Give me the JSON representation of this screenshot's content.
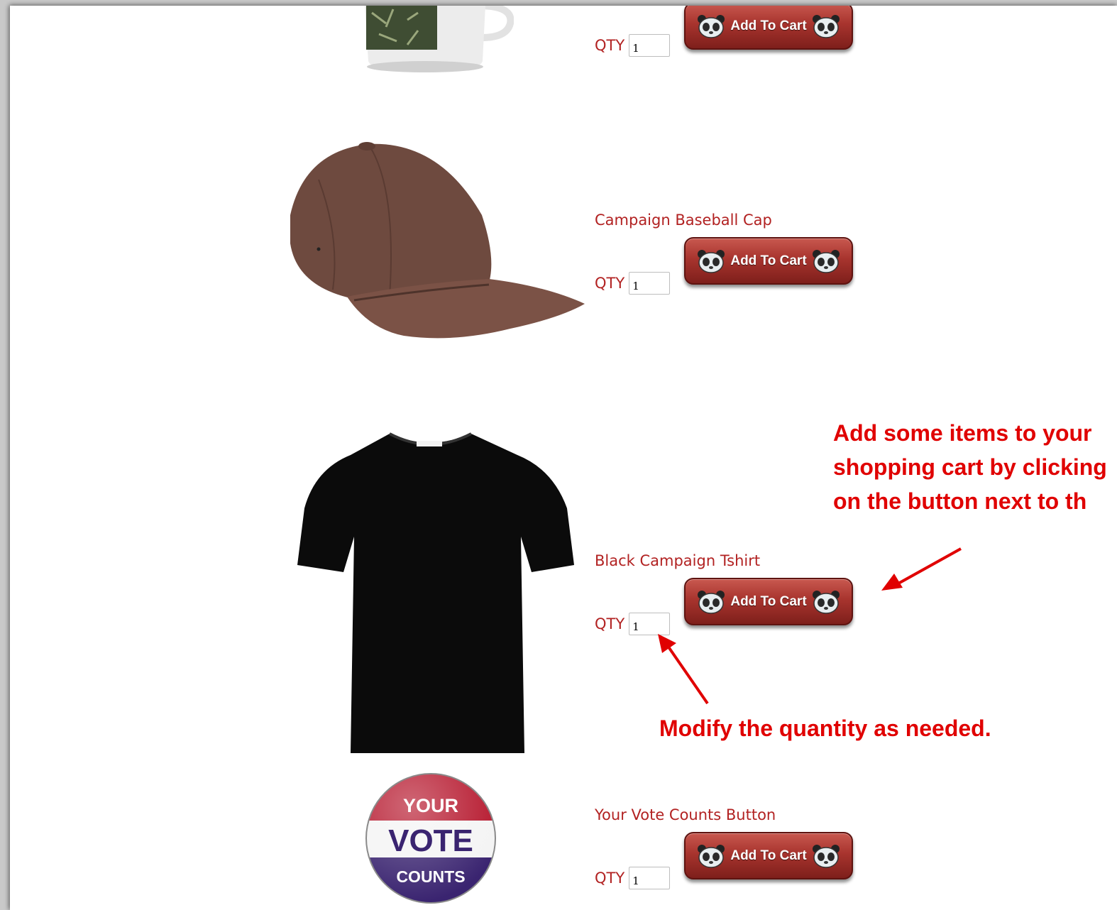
{
  "products": [
    {
      "name": "",
      "qty_label": "QTY",
      "qty": "1",
      "button_label": "Add To Cart"
    },
    {
      "name": "Campaign Baseball Cap",
      "qty_label": "QTY",
      "qty": "1",
      "button_label": "Add To Cart"
    },
    {
      "name": "Black Campaign Tshirt",
      "qty_label": "QTY",
      "qty": "1",
      "button_label": "Add To Cart"
    },
    {
      "name": "Your Vote Counts Button",
      "qty_label": "QTY",
      "qty": "1",
      "button_label": "Add To Cart"
    }
  ],
  "vote_badge": {
    "line1": "YOUR",
    "line2": "VOTE",
    "line3": "COUNTS"
  },
  "annotations": {
    "cart_line1": "Add some items to your",
    "cart_line2": "shopping cart by clicking",
    "cart_line3": "on the button next to th",
    "qty_note": "Modify the quantity as needed."
  },
  "colors": {
    "accent": "#b22222",
    "annotation": "#e00000",
    "button": "#a8342e"
  }
}
